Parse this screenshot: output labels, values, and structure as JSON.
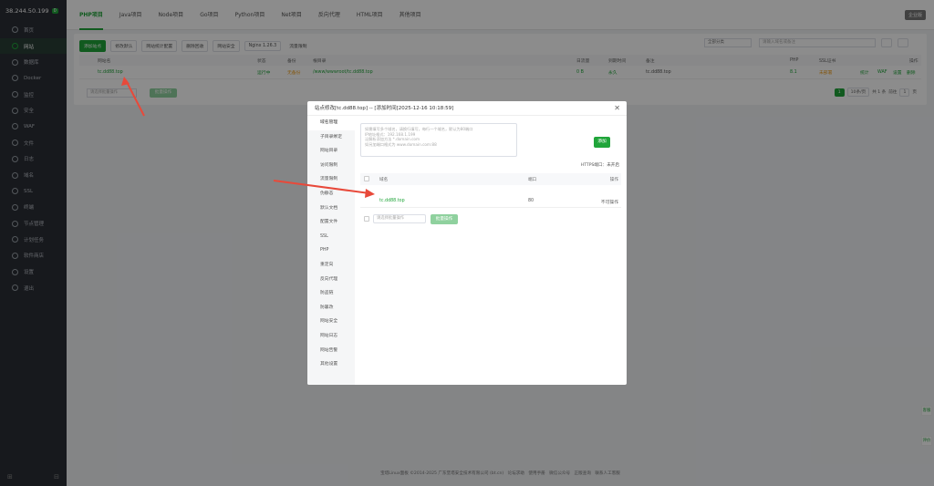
{
  "sidebar": {
    "server_ip": "38.244.50.199",
    "badge": "0",
    "items": [
      {
        "label": "首页",
        "icon": "home-icon"
      },
      {
        "label": "网站",
        "icon": "globe-icon",
        "active": true
      },
      {
        "label": "数据库",
        "icon": "database-icon"
      },
      {
        "label": "Docker",
        "icon": "docker-icon"
      },
      {
        "label": "监控",
        "icon": "monitor-icon"
      },
      {
        "label": "安全",
        "icon": "shield-icon"
      },
      {
        "label": "WAF",
        "icon": "waf-icon"
      },
      {
        "label": "文件",
        "icon": "folder-icon"
      },
      {
        "label": "日志",
        "icon": "log-icon"
      },
      {
        "label": "域名",
        "icon": "domain-icon"
      },
      {
        "label": "SSL",
        "icon": "ssl-icon"
      },
      {
        "label": "终端",
        "icon": "terminal-icon"
      },
      {
        "label": "节点管理",
        "icon": "node-icon"
      },
      {
        "label": "计划任务",
        "icon": "clock-icon"
      },
      {
        "label": "软件商店",
        "icon": "store-icon"
      },
      {
        "label": "设置",
        "icon": "gear-icon"
      },
      {
        "label": "退出",
        "icon": "logout-icon"
      }
    ]
  },
  "tabs": [
    "PHP项目",
    "Java项目",
    "Node项目",
    "Go项目",
    "Python项目",
    "Net项目",
    "反向代理",
    "HTML项目",
    "其他项目"
  ],
  "top_right_button": "企业版",
  "toolbar": {
    "add_site": "添加站点",
    "modify_defaults": "修改默认",
    "site_settings": "网站统计配置",
    "recycle_bin": "删除回收",
    "site_security": "网站安全",
    "nginx": "Nginx 1.26.3",
    "traffic": "流量限制",
    "category_select": "全部分类",
    "search_placeholder": "请输入域名或备注"
  },
  "table": {
    "headers": [
      "网站名",
      "状态",
      "备份",
      "根目录",
      "日流量",
      "到期时间",
      "备注",
      "PHP",
      "SSL证书",
      "操作"
    ],
    "row": {
      "name": "tc.dd88.top",
      "status": "运行中",
      "backup": "无备份",
      "root": "/www/wwwroot/tc.dd88.top",
      "traffic": "0 B",
      "expire": "永久",
      "note": "tc.dd88.top",
      "php": "8.1",
      "ssl": "未部署",
      "ops": [
        "统计",
        "WAF",
        "设置",
        "删除"
      ]
    },
    "batch_placeholder": "请选择批量操作",
    "batch_button": "批量操作",
    "pager": {
      "current": "1",
      "per_page": "10条/页",
      "total": "共 1 条",
      "goto": "前往",
      "page_input": "1",
      "page_suffix": "页"
    }
  },
  "modal": {
    "title": "站点修改[tc.dd88.top] -- [添加时间[2025-12-16 10:18:59]",
    "nav": [
      "域名管理",
      "子目录绑定",
      "网站目录",
      "访问限制",
      "流量限制",
      "伪静态",
      "默认文档",
      "配置文件",
      "SSL",
      "PHP",
      "重定向",
      "反向代理",
      "防盗链",
      "防篡改",
      "网站安全",
      "网站日志",
      "网站告警",
      "其他设置"
    ],
    "textarea_lines": [
      "如需填写多个域名，请换行填写，每行一个域名，默认为80端口",
      "IP地址格式：192.168.1.199",
      "泛解析添加方法 *.domain.com",
      "如另加端口格式为 www.domain.com:88"
    ],
    "add_button": "添加",
    "https_label": "HTTPS端口：未开启",
    "domain_table": {
      "headers": [
        "域名",
        "端口",
        "操作"
      ],
      "row": {
        "domain": "tc.dd88.top",
        "port": "80",
        "op": "不可操作"
      }
    },
    "batch_placeholder": "请选择批量操作",
    "batch_button": "批量操作"
  },
  "footer": {
    "copyright": "宝塔Linux面板 ©2014-2025 广东堡塔安全技术有限公司 (bt.cn)",
    "links": [
      "论坛求助",
      "使用手册",
      "微信公众号",
      "正版查询",
      "联系人工客服"
    ]
  },
  "float_buttons": [
    "客服",
    "评价"
  ]
}
